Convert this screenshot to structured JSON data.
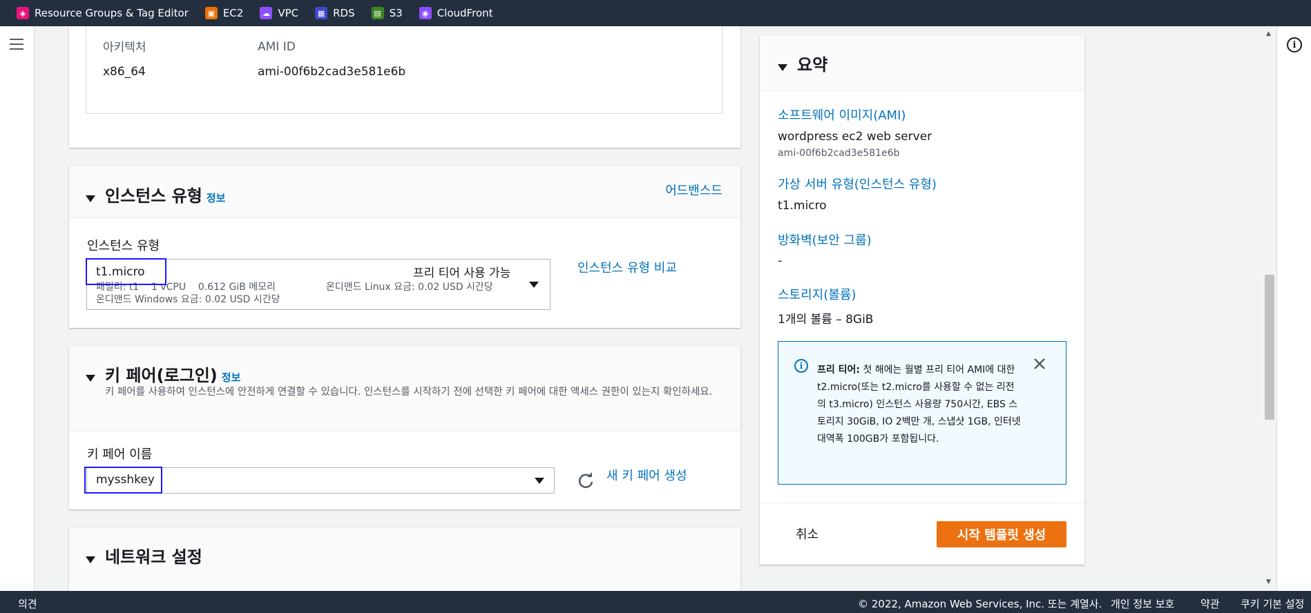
{
  "topbar": {
    "services": [
      {
        "label": "Resource Groups & Tag Editor",
        "icon": "resource-groups-icon",
        "color": "#e7157b"
      },
      {
        "label": "EC2",
        "icon": "ec2-icon",
        "color": "#ed7100"
      },
      {
        "label": "VPC",
        "icon": "vpc-icon",
        "color": "#8c4fff"
      },
      {
        "label": "RDS",
        "icon": "rds-icon",
        "color": "#3f48cc"
      },
      {
        "label": "S3",
        "icon": "s3-icon",
        "color": "#3f8624"
      },
      {
        "label": "CloudFront",
        "icon": "cloudfront-icon",
        "color": "#8c4fff"
      }
    ]
  },
  "ami_panel": {
    "arch_label": "아키텍처",
    "arch_value": "x86_64",
    "ami_id_label": "AMI ID",
    "ami_id_value": "ami-00f6b2cad3e581e6b"
  },
  "instance_type": {
    "title": "인스턴스 유형",
    "info": "정보",
    "advanced": "어드밴스드",
    "field_label": "인스턴스 유형",
    "selected": "t1.micro",
    "free_tier": "프리 티어 사용 가능",
    "details_line1": "패밀리: t1    1 vCPU    0.612 GiB 메모리",
    "details_linux": "온디맨드 Linux 요금: 0.02 USD 시간당",
    "details_line2": "온디맨드 Windows 요금: 0.02 USD 시간당",
    "compare_link": "인스턴스 유형 비교"
  },
  "key_pair": {
    "title": "키 페어(로그인)",
    "info": "정보",
    "description": "키 페어를 사용하여 인스턴스에 안전하게 연결할 수 있습니다. 인스턴스를 시작하기 전에 선택한 키 페어에 대한 액세스 권한이 있는지 확인하세요.",
    "field_label": "키 페어 이름",
    "selected": "mysshkey",
    "create_link": "새 키 페어 생성"
  },
  "network": {
    "title": "네트워크 설정"
  },
  "summary": {
    "title": "요약",
    "ami_label": "소프트웨어 이미지(AMI)",
    "ami_name": "wordpress ec2 web server",
    "ami_id": "ami-00f6b2cad3e581e6b",
    "vs_label": "가상 서버 유형(인스턴스 유형)",
    "vs_value": "t1.micro",
    "fw_label": "방화벽(보안 그룹)",
    "fw_value": "-",
    "storage_label": "스토리지(볼륨)",
    "storage_value": "1개의 볼륨 – 8GiB",
    "alert_bold": "프리 티어:",
    "alert_text": "첫 해에는 월별 프리 티어 AMI에 대한 t2.micro(또는 t2.micro를 사용할 수 없는 리전의 t3.micro) 인스턴스 사용량 750시간, EBS 스토리지 30GiB, IO 2백만 개, 스냅샷 1GB, 인터넷 대역폭 100GB가 포함됩니다.",
    "cancel": "취소",
    "submit": "시작 템플릿 생성"
  },
  "footer": {
    "feedback": "의견",
    "copyright": "© 2022, Amazon Web Services, Inc. 또는 계열사.",
    "privacy": "개인 정보 보호",
    "terms": "약관",
    "cookies": "쿠키 기본 설정"
  }
}
